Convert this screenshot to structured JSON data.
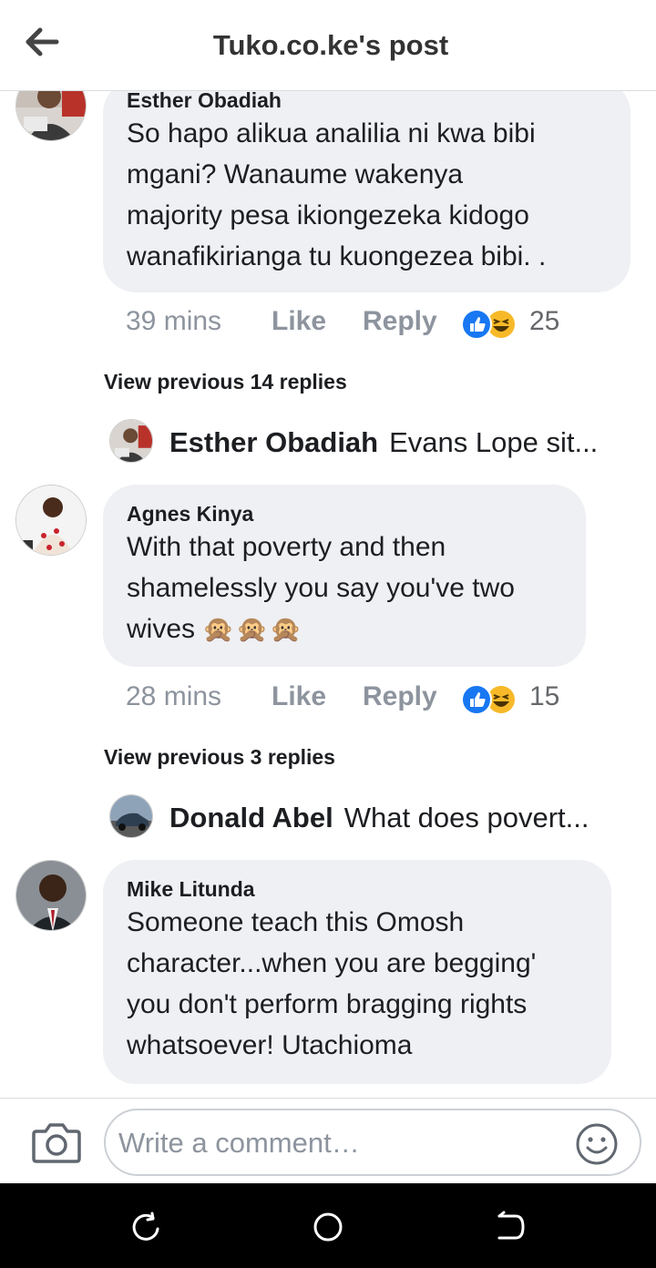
{
  "header": {
    "title": "Tuko.co.ke's post",
    "back_icon": "arrow-left-icon"
  },
  "comments": [
    {
      "author": "Esther Obadiah",
      "lines": [
        "So hapo alikua analilia ni kwa bibi",
        "mgani? Wanaume wakenya",
        "majority pesa ikiongezeka kidogo",
        "wanafikirianga tu kuongezea bibi. ."
      ],
      "time": "39 mins",
      "like": "Like",
      "reply": "Reply",
      "reaction_count": "25",
      "view_previous": "View previous 14 replies",
      "latest_reply": {
        "author": "Esther Obadiah",
        "text": "Evans Lope sit..."
      }
    },
    {
      "author": "Agnes Kinya",
      "lines": [
        "With that poverty and then",
        "shamelessly you say you've two",
        "wives"
      ],
      "emoji": "🙊🙊🙊",
      "time": "28 mins",
      "like": "Like",
      "reply": "Reply",
      "reaction_count": "15",
      "view_previous": "View previous 3 replies",
      "latest_reply": {
        "author": "Donald Abel",
        "text": "What does povert..."
      }
    },
    {
      "author": "Mike Litunda",
      "lines": [
        "Someone teach this Omosh",
        "character...when you are begging'",
        "you don't perform bragging rights",
        "whatsoever! Utachioma"
      ]
    }
  ],
  "reaction_icons": [
    "like-reaction-icon",
    "haha-reaction-icon"
  ],
  "composer": {
    "placeholder": "Write a comment…",
    "camera_icon": "camera-icon",
    "emoji_icon": "smiley-icon"
  },
  "nav": {
    "icons": [
      "recents-icon",
      "home-icon",
      "back-icon"
    ]
  },
  "colors": {
    "bubble": "#eff0f3",
    "meta_text": "#8d949e",
    "like_blue": "#1877f2",
    "haha_yellow": "#f7b928",
    "navbar": "#000000"
  }
}
